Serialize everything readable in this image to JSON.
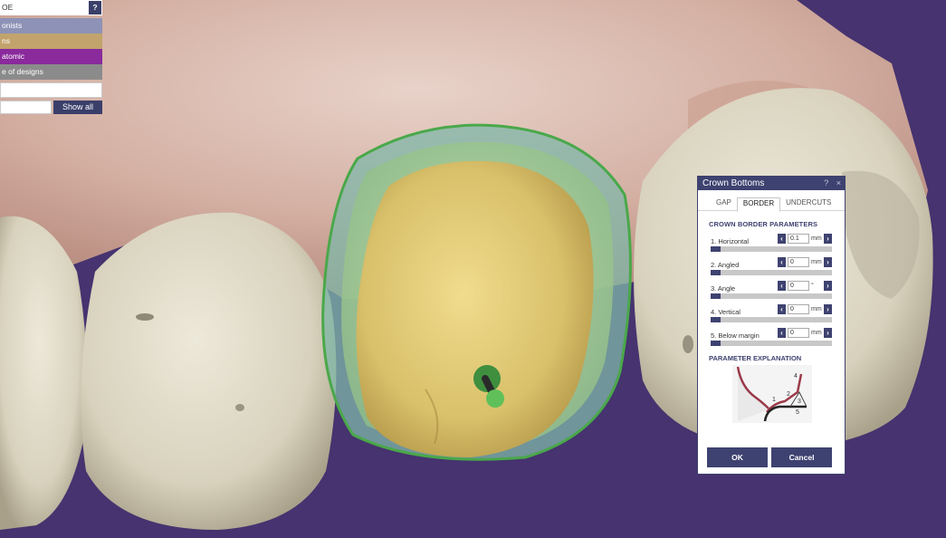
{
  "layers_panel": {
    "header_label": "OE",
    "help_label": "?",
    "items": [
      {
        "label": "onists"
      },
      {
        "label": "ns"
      },
      {
        "label": "atomic"
      },
      {
        "label": "e of designs"
      }
    ],
    "show_all_label": "Show all",
    "colors": {
      "antagonists": "#8d92b6",
      "preparations": "#c2a36c",
      "anatomic": "#8a2a9c",
      "library": "#8b8b8b"
    }
  },
  "dialog": {
    "title": "Crown Bottoms",
    "help_icon": "?",
    "close_icon": "×",
    "tabs": [
      {
        "label": "GAP",
        "active": false
      },
      {
        "label": "BORDER",
        "active": true
      },
      {
        "label": "UNDERCUTS",
        "active": false
      }
    ],
    "section_title": "CROWN BORDER PARAMETERS",
    "params": [
      {
        "label": "1. Horizontal",
        "value": "0.1",
        "unit": "mm"
      },
      {
        "label": "2. Angled",
        "value": "0",
        "unit": "mm"
      },
      {
        "label": "3. Angle",
        "value": "0",
        "unit": "°"
      },
      {
        "label": "4. Vertical",
        "value": "0",
        "unit": "mm"
      },
      {
        "label": "5. Below margin",
        "value": "0",
        "unit": "mm"
      }
    ],
    "explanation_title": "PARAMETER EXPLANATION",
    "diagram_labels": [
      "1",
      "2",
      "3",
      "4",
      "5"
    ],
    "ok_label": "OK",
    "cancel_label": "Cancel",
    "accent_color": "#3e4270"
  },
  "scene": {
    "background_color": "#46336f",
    "gum_color": "#d6b8aa",
    "tooth_color": "#e0dccb",
    "crown_color": "#d9c270",
    "margin_line_color": "#4aa84a"
  }
}
